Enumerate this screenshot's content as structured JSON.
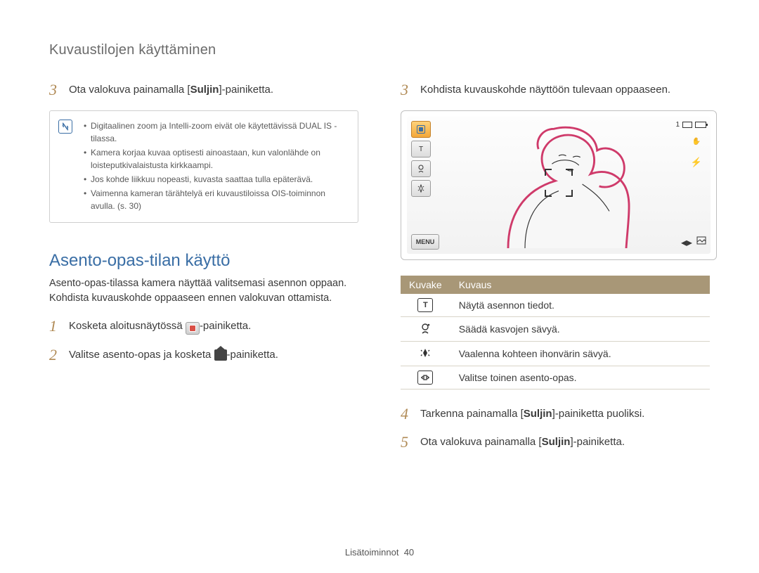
{
  "header": "Kuvaustilojen käyttäminen",
  "left": {
    "step3": {
      "num": "3",
      "prefix": "Ota valokuva painamalla [",
      "bold": "Suljin",
      "suffix": "]-painiketta."
    },
    "notes": [
      "Digitaalinen zoom ja Intelli-zoom eivät ole käytettävissä DUAL IS -tilassa.",
      "Kamera korjaa kuvaa optisesti ainoastaan, kun valonlähde on loisteputkivalaistusta kirkkaampi.",
      "Jos kohde liikkuu nopeasti, kuvasta saattaa tulla epäterävä.",
      "Vaimenna kameran tärähtelyä eri kuvaustiloissa OIS-toiminnon avulla. (s. 30)"
    ],
    "section_title": "Asento-opas-tilan käyttö",
    "section_desc": "Asento-opas-tilassa kamera näyttää valitsemasi asennon oppaan. Kohdista kuvauskohde oppaaseen ennen valokuvan ottamista.",
    "step1": {
      "num": "1",
      "prefix": "Kosketa aloitusnäytössä ",
      "suffix": "-painiketta."
    },
    "step2": {
      "num": "2",
      "prefix": "Valitse asento-opas ja kosketa ",
      "suffix": "-painiketta."
    }
  },
  "right": {
    "step3": {
      "num": "3",
      "text": "Kohdista kuvauskohde näyttöön tulevaan oppaaseen."
    },
    "cam": {
      "menu": "MENU",
      "t": "T",
      "count": "1"
    },
    "table": {
      "headers": [
        "Kuvake",
        "Kuvaus"
      ],
      "rows": [
        {
          "icon": "T",
          "desc": "Näytä asennon tiedot."
        },
        {
          "icon": "face",
          "desc": "Säädä kasvojen sävyä."
        },
        {
          "icon": "sparkle",
          "desc": "Vaalenna kohteen ihonvärin sävyä."
        },
        {
          "icon": "arrows",
          "desc": "Valitse toinen asento-opas."
        }
      ]
    },
    "step4": {
      "num": "4",
      "prefix": "Tarkenna painamalla [",
      "bold": "Suljin",
      "suffix": "]-painiketta puoliksi."
    },
    "step5": {
      "num": "5",
      "prefix": "Ota valokuva painamalla [",
      "bold": "Suljin",
      "suffix": "]-painiketta."
    }
  },
  "footer": {
    "label": "Lisätoiminnot",
    "page": "40"
  }
}
